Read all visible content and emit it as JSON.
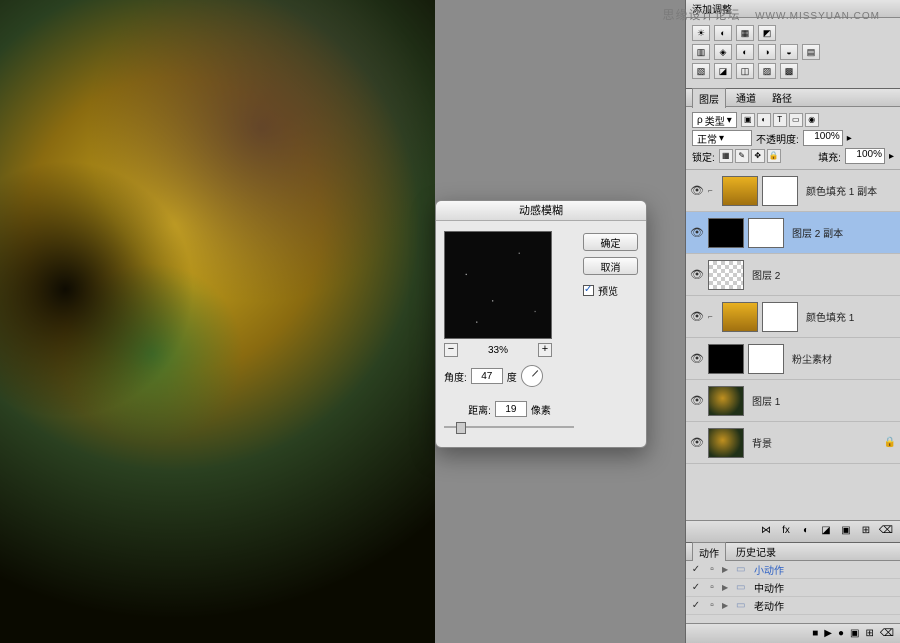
{
  "watermark": {
    "site": "思缘设计论坛",
    "url": "WWW.MISSYUAN.COM"
  },
  "dialog": {
    "title": "动感模糊",
    "ok": "确定",
    "cancel": "取消",
    "preview_label": "预览",
    "preview_checked": true,
    "zoom": "33%",
    "minus": "−",
    "plus": "+",
    "angle_label": "角度:",
    "angle_value": "47",
    "angle_unit": "度",
    "distance_label": "距离:",
    "distance_value": "19",
    "distance_unit": "像素"
  },
  "adjustments": {
    "title": "添加调整",
    "row1": [
      "☀",
      "◐",
      "▦",
      "◩"
    ],
    "row2": [
      "▥",
      "◈",
      "◐",
      "◑",
      "◒",
      "▤"
    ],
    "row3": [
      "▧",
      "◪",
      "◫",
      "▨",
      "▩"
    ]
  },
  "layers": {
    "tabs": [
      "图层",
      "通道",
      "路径"
    ],
    "type_label": "类型",
    "blend_mode": "正常",
    "opacity_label": "不透明度:",
    "opacity_value": "100%",
    "lock_label": "锁定:",
    "fill_label": "填充:",
    "fill_value": "100%",
    "items": [
      {
        "name": "颜色填充 1 副本",
        "thumbs": [
          "gold",
          "mask"
        ],
        "indent": true
      },
      {
        "name": "图层 2 副本",
        "thumbs": [
          "black",
          "mask"
        ],
        "selected": true
      },
      {
        "name": "图层 2",
        "thumbs": [
          "checker"
        ]
      },
      {
        "name": "颜色填充 1",
        "thumbs": [
          "gold",
          "mask"
        ],
        "indent": true
      },
      {
        "name": "粉尘素材",
        "thumbs": [
          "black",
          "mask"
        ]
      },
      {
        "name": "图层 1",
        "thumbs": [
          "img"
        ]
      },
      {
        "name": "背景",
        "thumbs": [
          "img"
        ],
        "locked": true
      }
    ],
    "footer_icons": [
      "⋈",
      "fx",
      "◐",
      "◪",
      "▣",
      "⊞",
      "⌫"
    ]
  },
  "actions": {
    "tabs": [
      "动作",
      "历史记录"
    ],
    "items": [
      {
        "name": "小动作",
        "blue": true
      },
      {
        "name": "中动作"
      },
      {
        "name": "老动作"
      }
    ],
    "footer_icons": [
      "■",
      "▶",
      "●",
      "▣",
      "⊞",
      "⌫"
    ]
  }
}
